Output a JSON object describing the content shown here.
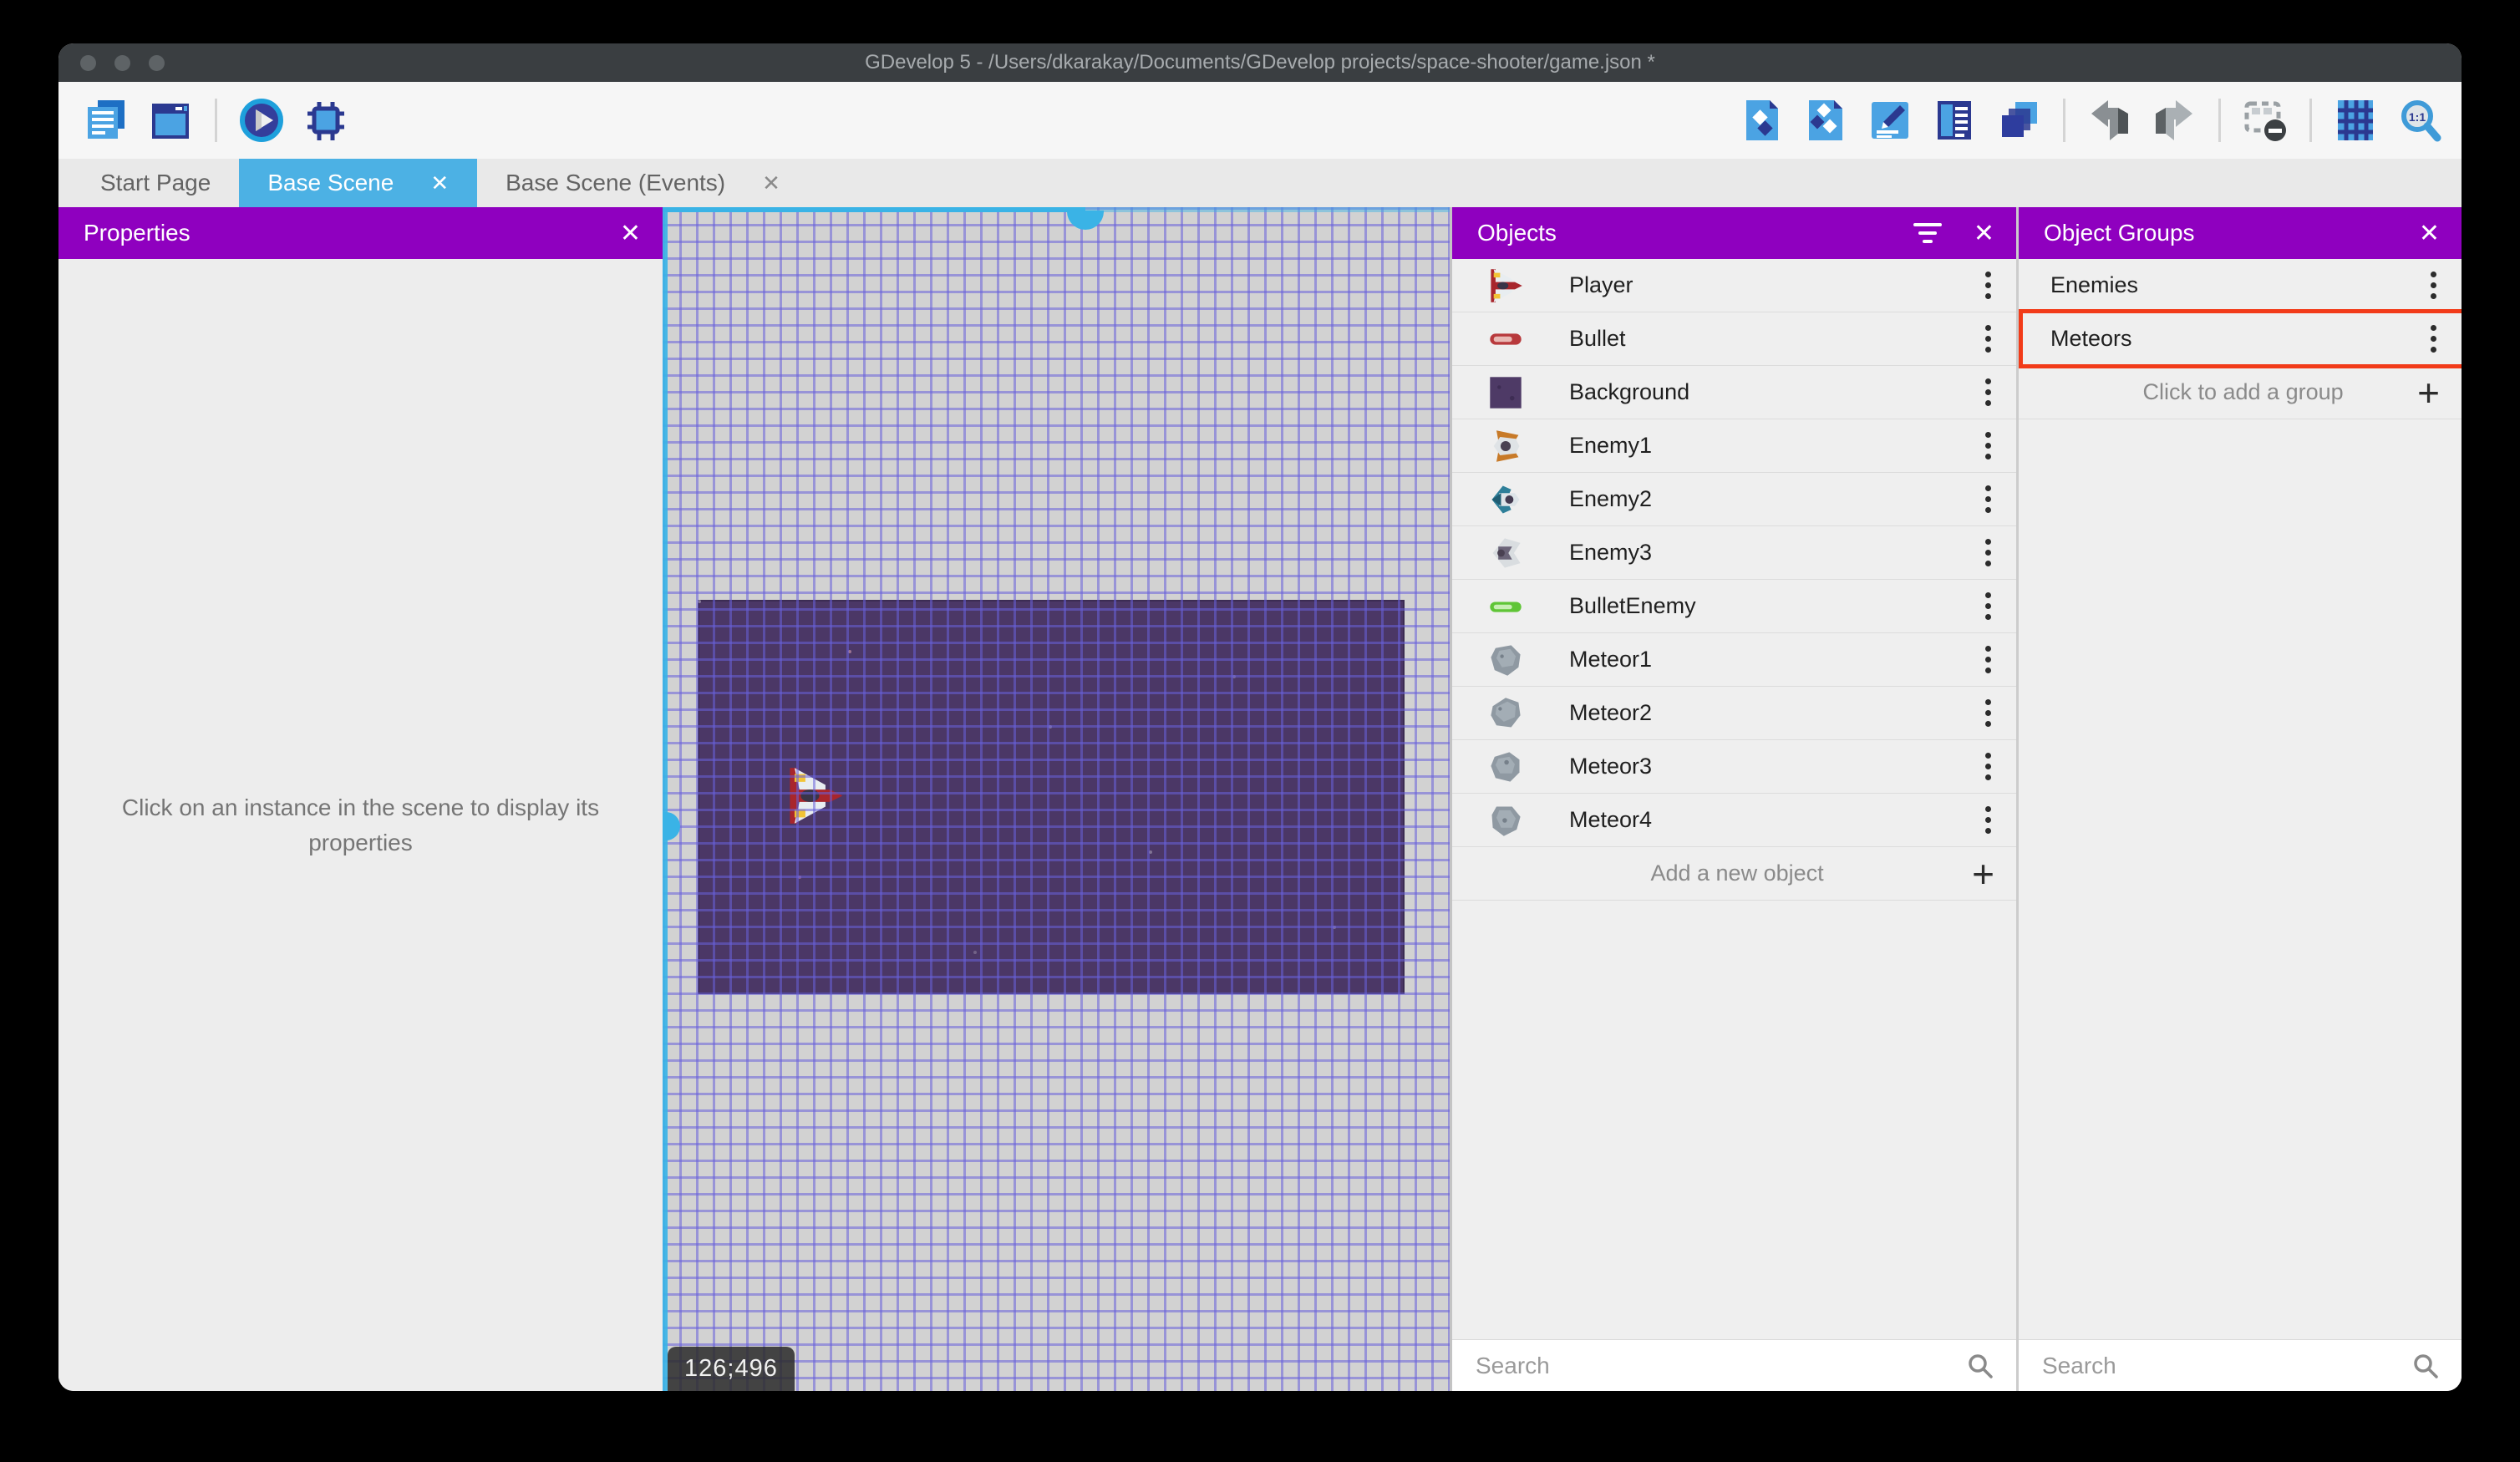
{
  "window": {
    "title": "GDevelop 5 - /Users/dkarakay/Documents/GDevelop projects/space-shooter/game.json *"
  },
  "toolbar": {
    "left_icons": [
      "project-manager-icon",
      "scene-editor-icon",
      "preview-play-icon",
      "debug-icon"
    ],
    "right_icons": [
      "objects-panel-icon",
      "object-groups-panel-icon",
      "properties-panel-icon",
      "instances-list-icon",
      "layers-panel-icon",
      "undo-icon",
      "redo-icon",
      "toggle-mask-icon",
      "toggle-grid-icon",
      "zoom-reset-icon"
    ]
  },
  "tabs": [
    {
      "label": "Start Page",
      "active": false,
      "closable": false
    },
    {
      "label": "Base Scene",
      "active": true,
      "closable": true
    },
    {
      "label": "Base Scene (Events)",
      "active": false,
      "closable": true
    }
  ],
  "properties_panel": {
    "title": "Properties",
    "empty_message": "Click on an instance in the scene to display its properties"
  },
  "scene": {
    "coordinates": "126;496"
  },
  "objects_panel": {
    "title": "Objects",
    "items": [
      {
        "name": "Player",
        "icon": "player"
      },
      {
        "name": "Bullet",
        "icon": "bullet-red"
      },
      {
        "name": "Background",
        "icon": "background"
      },
      {
        "name": "Enemy1",
        "icon": "enemy-orange"
      },
      {
        "name": "Enemy2",
        "icon": "enemy-teal"
      },
      {
        "name": "Enemy3",
        "icon": "enemy-gray"
      },
      {
        "name": "BulletEnemy",
        "icon": "bullet-green"
      },
      {
        "name": "Meteor1",
        "icon": "meteor-a"
      },
      {
        "name": "Meteor2",
        "icon": "meteor-b"
      },
      {
        "name": "Meteor3",
        "icon": "meteor-c"
      },
      {
        "name": "Meteor4",
        "icon": "meteor-d"
      }
    ],
    "add_label": "Add a new object",
    "search_placeholder": "Search"
  },
  "groups_panel": {
    "title": "Object Groups",
    "items": [
      {
        "name": "Enemies",
        "highlighted": false
      },
      {
        "name": "Meteors",
        "highlighted": true
      }
    ],
    "add_label": "Click to add a group",
    "search_placeholder": "Search"
  },
  "icons": {
    "close_glyph": "✕",
    "add_glyph": "+"
  },
  "colors": {
    "panel_header": "#8f00bf",
    "active_tab": "#4cb1e4",
    "selection": "#3ab3e6",
    "annotation": "#f23b19",
    "titlebar": "#3a3e41"
  }
}
